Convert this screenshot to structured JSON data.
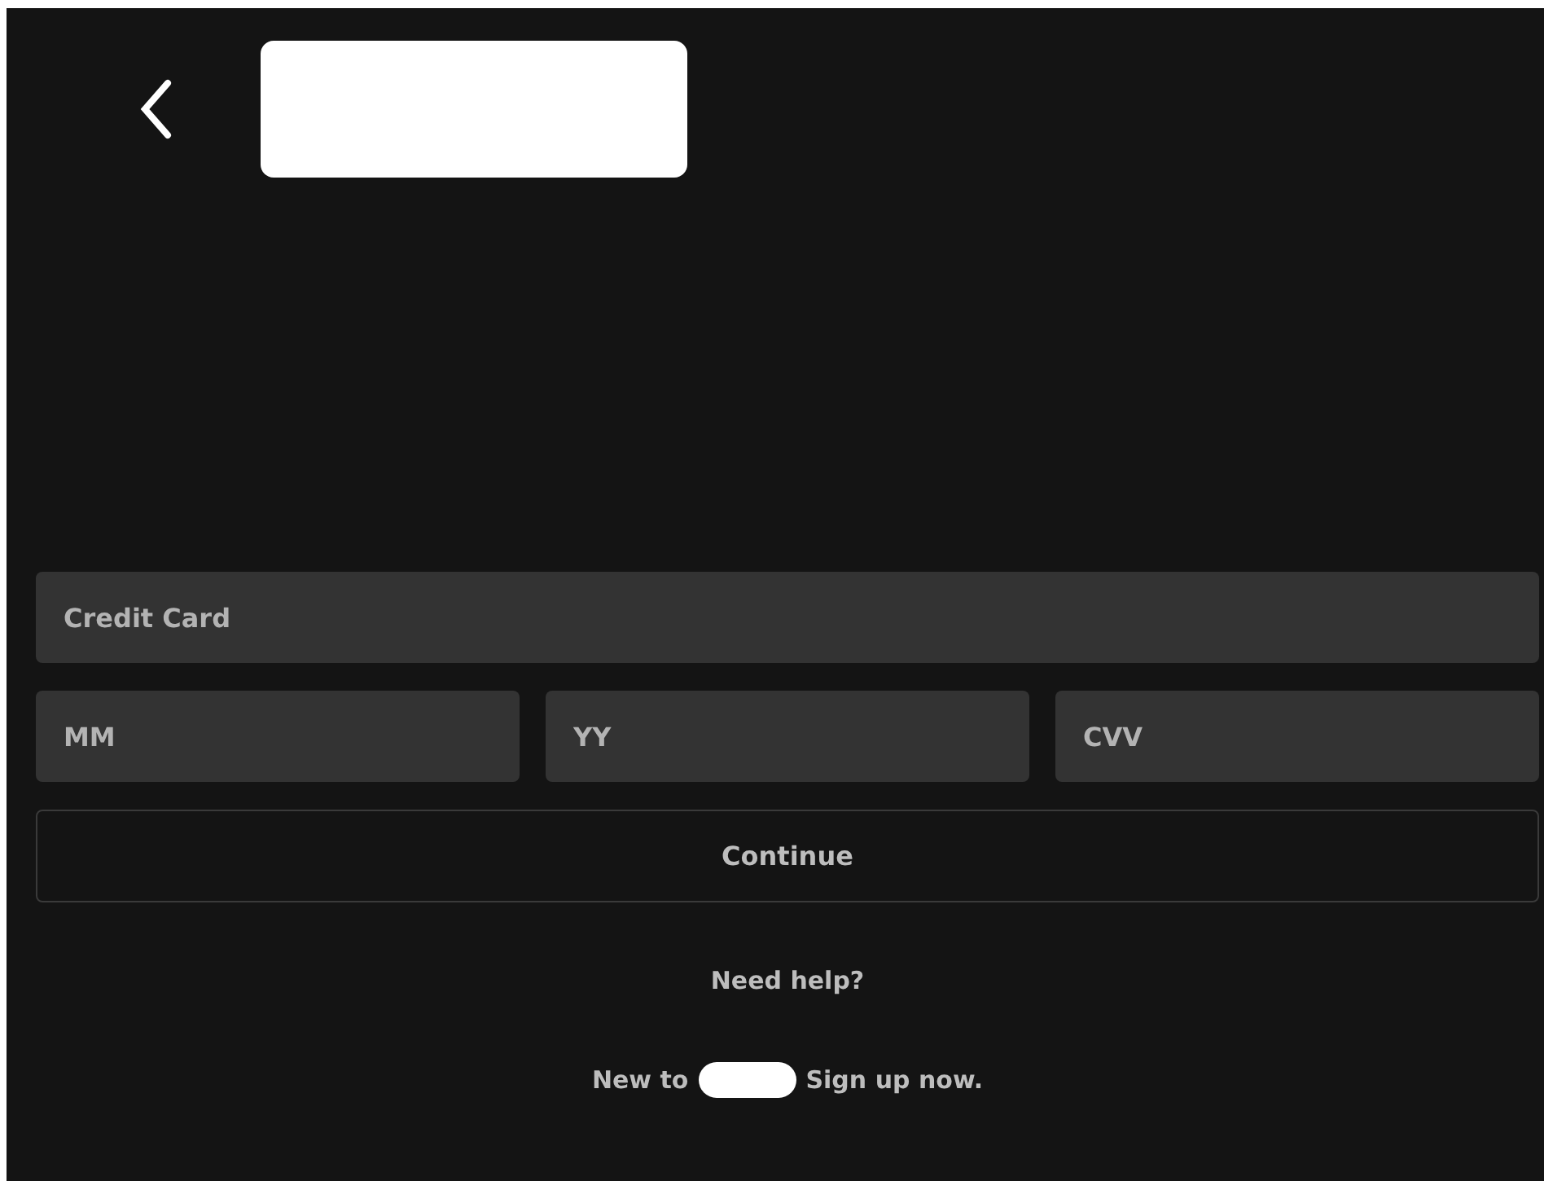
{
  "card_field": {
    "placeholder": "Credit Card"
  },
  "detail_fields": [
    {
      "placeholder": "MM"
    },
    {
      "placeholder": "YY"
    },
    {
      "placeholder": "CVV"
    }
  ],
  "continue_button": "Continue",
  "help_link": "Need help?",
  "signup": {
    "prefix": "New to",
    "link": "Sign up now."
  }
}
